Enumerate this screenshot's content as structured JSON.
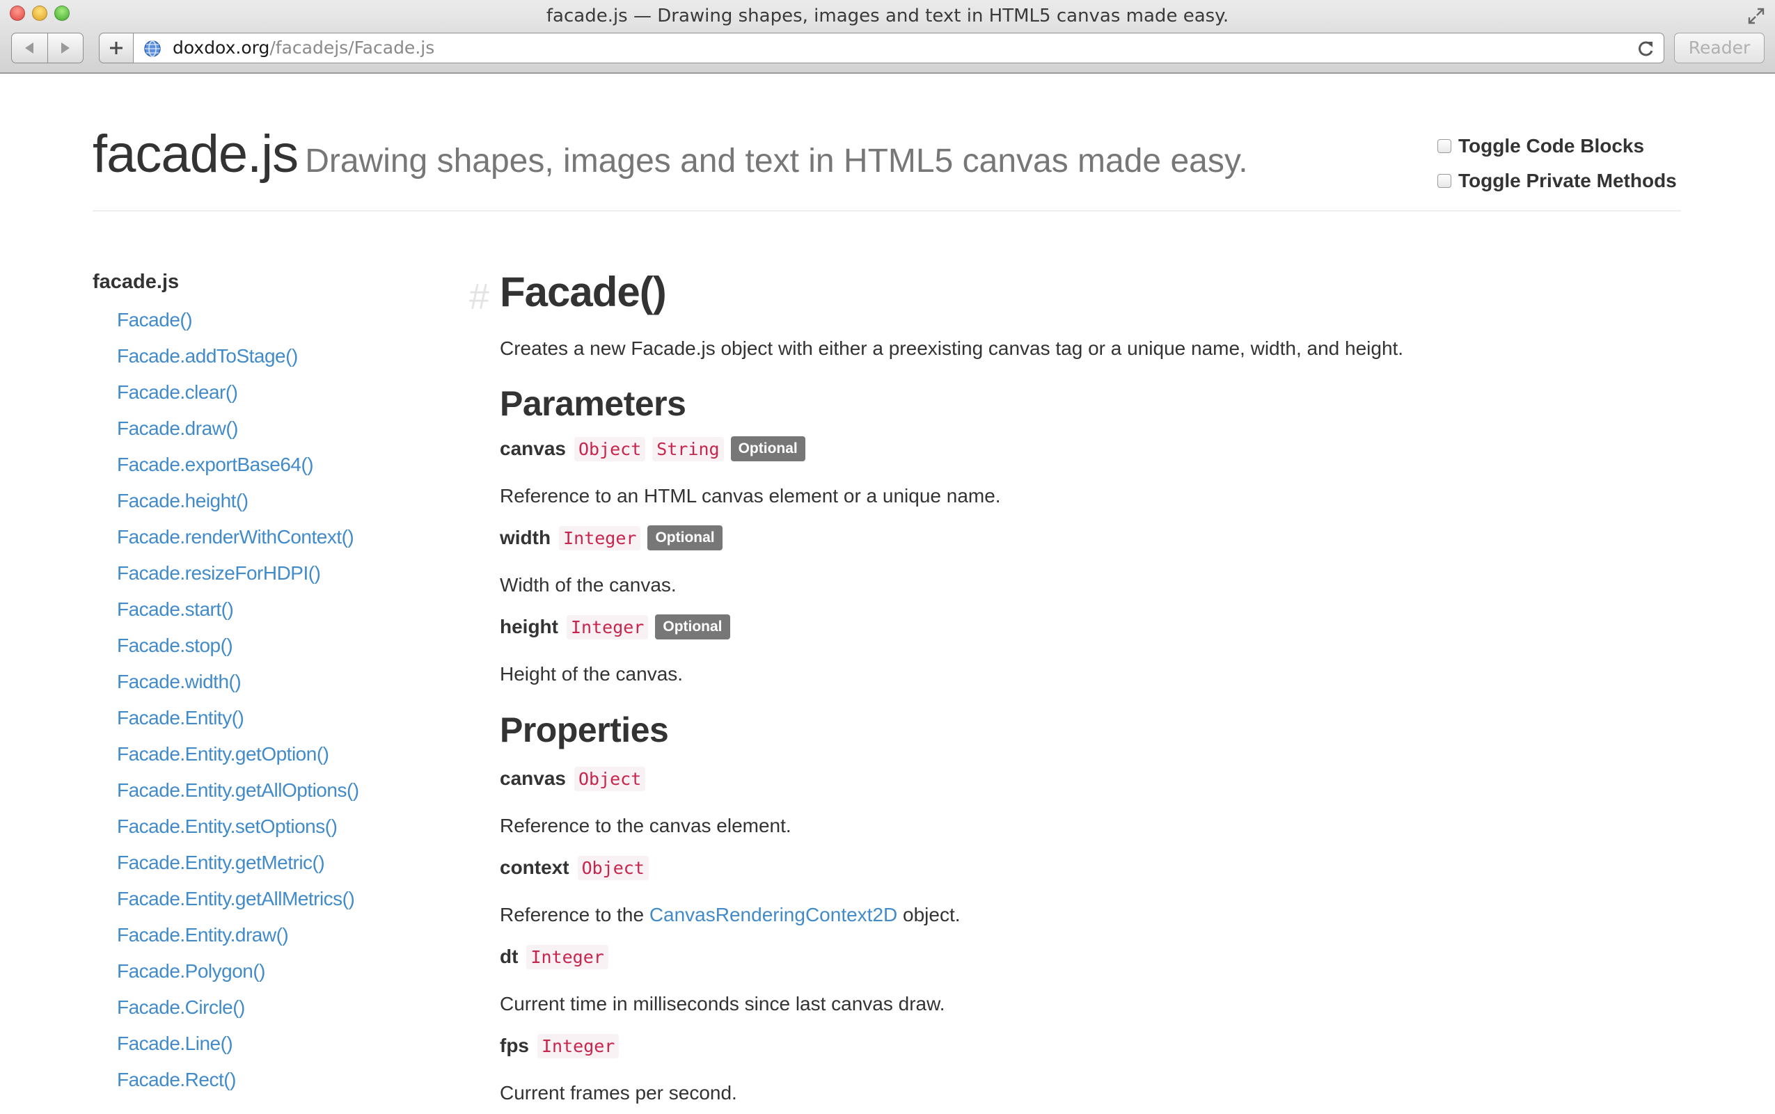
{
  "browser": {
    "window_title": "facade.js — Drawing shapes, images and text in HTML5 canvas made easy.",
    "url_domain": "doxdox.org",
    "url_path": "/facadejs/Facade.js",
    "reader_label": "Reader"
  },
  "header": {
    "title": "facade.js",
    "description": "Drawing shapes, images and text in HTML5 canvas made easy.",
    "toggle_code_blocks": "Toggle Code Blocks",
    "toggle_private_methods": "Toggle Private Methods"
  },
  "sidebar": {
    "heading": "facade.js",
    "items": [
      "Facade()",
      "Facade.addToStage()",
      "Facade.clear()",
      "Facade.draw()",
      "Facade.exportBase64()",
      "Facade.height()",
      "Facade.renderWithContext()",
      "Facade.resizeForHDPI()",
      "Facade.start()",
      "Facade.stop()",
      "Facade.width()",
      "Facade.Entity()",
      "Facade.Entity.getOption()",
      "Facade.Entity.getAllOptions()",
      "Facade.Entity.setOptions()",
      "Facade.Entity.getMetric()",
      "Facade.Entity.getAllMetrics()",
      "Facade.Entity.draw()",
      "Facade.Polygon()",
      "Facade.Circle()",
      "Facade.Line()",
      "Facade.Rect()"
    ]
  },
  "main": {
    "hash": "#",
    "title": "Facade()",
    "description": "Creates a new Facade.js object with either a preexisting canvas tag or a unique name, width, and height.",
    "parameters_heading": "Parameters",
    "parameters": [
      {
        "name": "canvas",
        "types": [
          "Object",
          "String"
        ],
        "badge": "Optional",
        "description": "Reference to an HTML canvas element or a unique name."
      },
      {
        "name": "width",
        "types": [
          "Integer"
        ],
        "badge": "Optional",
        "description": "Width of the canvas."
      },
      {
        "name": "height",
        "types": [
          "Integer"
        ],
        "badge": "Optional",
        "description": "Height of the canvas."
      }
    ],
    "properties_heading": "Properties",
    "properties": [
      {
        "name": "canvas",
        "type": "Object",
        "description": "Reference to the canvas element."
      },
      {
        "name": "context",
        "type": "Object",
        "description_before": "Reference to the ",
        "description_link": "CanvasRenderingContext2D",
        "description_after": " object."
      },
      {
        "name": "dt",
        "type": "Integer",
        "description": "Current time in milliseconds since last canvas draw."
      },
      {
        "name": "fps",
        "type": "Integer",
        "description": "Current frames per second."
      }
    ]
  }
}
